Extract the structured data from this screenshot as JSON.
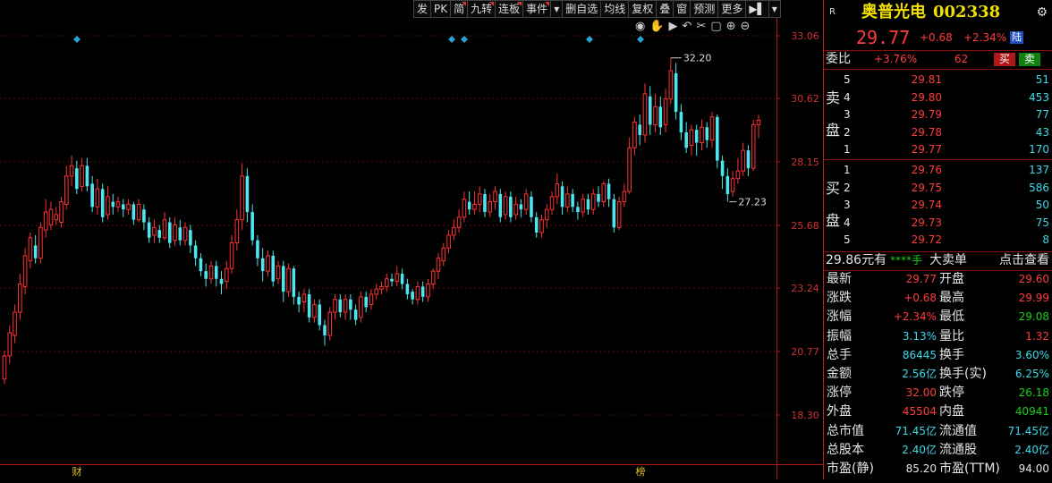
{
  "toolbar": {
    "buttons": [
      {
        "label": "发",
        "flag": false
      },
      {
        "label": "PK",
        "flag": false
      },
      {
        "label": "简",
        "flag": true
      },
      {
        "label": "九转",
        "flag": true
      },
      {
        "label": "连板",
        "flag": true
      },
      {
        "label": "事件",
        "flag": true
      },
      {
        "label": "▾",
        "flag": false
      },
      {
        "label": "删自选",
        "flag": false
      },
      {
        "label": "均线",
        "flag": false
      },
      {
        "label": "复权",
        "flag": false
      },
      {
        "label": "叠",
        "flag": false
      },
      {
        "label": "窗",
        "flag": false
      },
      {
        "label": "预测",
        "flag": false
      },
      {
        "label": "更多",
        "flag": false
      },
      {
        "label": "▶▌",
        "flag": false
      },
      {
        "label": "▾",
        "flag": false
      }
    ]
  },
  "chart_data": {
    "type": "candlestick",
    "y_ticks": [
      "33.06",
      "30.62",
      "28.15",
      "25.68",
      "23.24",
      "20.77",
      "18.30"
    ],
    "ylim": [
      18.3,
      33.06
    ],
    "high_label": "32.20",
    "low_label": "27.23",
    "bottom_markers": [
      "财",
      "榜"
    ],
    "colors": {
      "up": "#ff3232",
      "down": "#4ce6f0",
      "grid": "#5a0e0e",
      "axis": "#b01818",
      "diamond": "#2aa0d8"
    },
    "candles": [
      [
        19.7,
        20.6,
        19.5,
        20.8
      ],
      [
        20.6,
        21.5,
        20.3,
        21.8
      ],
      [
        21.4,
        22.3,
        21.1,
        22.6
      ],
      [
        22.3,
        23.4,
        22.0,
        23.8
      ],
      [
        23.3,
        24.5,
        23.0,
        24.8
      ],
      [
        24.3,
        25.2,
        24.0,
        25.4
      ],
      [
        24.9,
        24.4,
        24.2,
        25.3
      ],
      [
        24.4,
        25.6,
        24.2,
        25.8
      ],
      [
        25.5,
        26.2,
        25.2,
        26.7
      ],
      [
        25.7,
        26.3,
        25.5,
        26.6
      ],
      [
        25.9,
        26.1,
        25.7,
        26.4
      ],
      [
        25.8,
        26.6,
        25.6,
        26.8
      ],
      [
        26.5,
        27.6,
        26.3,
        28.0
      ],
      [
        27.6,
        28.0,
        27.2,
        28.4
      ],
      [
        27.9,
        27.1,
        26.9,
        28.2
      ],
      [
        27.2,
        28.0,
        27.0,
        28.3
      ],
      [
        28.0,
        27.2,
        27.0,
        28.3
      ],
      [
        27.3,
        26.4,
        26.2,
        27.6
      ],
      [
        26.4,
        27.1,
        26.1,
        27.5
      ],
      [
        27.1,
        26.0,
        25.8,
        27.3
      ],
      [
        26.1,
        26.8,
        25.9,
        27.2
      ],
      [
        26.6,
        26.4,
        26.1,
        26.9
      ],
      [
        26.4,
        26.6,
        26.2,
        26.8
      ],
      [
        26.5,
        26.3,
        26.0,
        26.7
      ],
      [
        26.3,
        26.5,
        26.1,
        26.7
      ],
      [
        26.5,
        25.9,
        25.7,
        26.6
      ],
      [
        25.9,
        26.5,
        25.8,
        26.7
      ],
      [
        26.3,
        25.8,
        25.5,
        26.5
      ],
      [
        25.8,
        25.2,
        25.0,
        26.0
      ],
      [
        25.3,
        25.6,
        25.0,
        25.9
      ],
      [
        25.5,
        25.2,
        25.0,
        25.7
      ],
      [
        25.2,
        25.9,
        25.1,
        26.2
      ],
      [
        25.8,
        25.0,
        24.8,
        26.0
      ],
      [
        25.1,
        25.7,
        24.9,
        26.0
      ],
      [
        25.6,
        25.1,
        24.9,
        25.9
      ],
      [
        25.1,
        25.6,
        24.9,
        25.8
      ],
      [
        25.5,
        24.9,
        24.6,
        25.7
      ],
      [
        24.9,
        24.4,
        24.1,
        25.1
      ],
      [
        24.4,
        23.9,
        23.7,
        24.6
      ],
      [
        23.9,
        23.6,
        23.3,
        24.2
      ],
      [
        23.6,
        24.1,
        23.4,
        24.3
      ],
      [
        24.1,
        23.6,
        23.3,
        24.3
      ],
      [
        23.6,
        23.4,
        23.0,
        23.9
      ],
      [
        23.5,
        24.0,
        23.2,
        24.3
      ],
      [
        24.0,
        25.0,
        23.8,
        25.3
      ],
      [
        25.0,
        25.9,
        24.7,
        26.3
      ],
      [
        25.9,
        27.6,
        25.5,
        28.1
      ],
      [
        27.6,
        26.2,
        25.8,
        27.9
      ],
      [
        26.2,
        25.1,
        24.9,
        26.5
      ],
      [
        25.1,
        24.4,
        24.1,
        25.3
      ],
      [
        24.4,
        23.9,
        23.5,
        24.8
      ],
      [
        23.9,
        24.5,
        23.7,
        24.7
      ],
      [
        24.5,
        23.5,
        23.3,
        24.7
      ],
      [
        23.6,
        24.1,
        23.4,
        24.3
      ],
      [
        24.1,
        23.1,
        22.7,
        24.3
      ],
      [
        23.1,
        24.0,
        22.9,
        24.2
      ],
      [
        24.0,
        22.9,
        22.6,
        24.1
      ],
      [
        22.9,
        22.6,
        22.3,
        23.1
      ],
      [
        22.7,
        23.0,
        22.3,
        23.2
      ],
      [
        23.0,
        22.1,
        21.9,
        23.2
      ],
      [
        22.1,
        22.6,
        21.9,
        22.8
      ],
      [
        22.6,
        21.8,
        21.6,
        22.8
      ],
      [
        21.8,
        21.4,
        21.0,
        22.0
      ],
      [
        21.4,
        22.3,
        21.2,
        22.5
      ],
      [
        22.3,
        22.8,
        22.0,
        23.0
      ],
      [
        22.8,
        22.3,
        22.1,
        23.0
      ],
      [
        22.3,
        22.8,
        22.0,
        23.0
      ],
      [
        22.8,
        22.4,
        22.0,
        23.0
      ],
      [
        22.4,
        22.0,
        21.8,
        22.6
      ],
      [
        22.1,
        22.9,
        21.9,
        23.1
      ],
      [
        22.9,
        22.5,
        22.3,
        23.1
      ],
      [
        22.6,
        23.0,
        22.4,
        23.2
      ],
      [
        23.0,
        23.2,
        22.8,
        23.4
      ],
      [
        23.2,
        23.3,
        23.0,
        23.5
      ],
      [
        23.3,
        23.6,
        23.1,
        23.8
      ],
      [
        23.6,
        23.5,
        23.3,
        23.8
      ],
      [
        23.5,
        23.8,
        23.3,
        24.1
      ],
      [
        23.8,
        23.4,
        23.2,
        24.0
      ],
      [
        23.4,
        23.0,
        22.8,
        23.6
      ],
      [
        23.1,
        22.8,
        22.6,
        23.2
      ],
      [
        22.8,
        23.3,
        22.6,
        23.5
      ],
      [
        23.3,
        22.9,
        22.7,
        23.5
      ],
      [
        22.9,
        23.4,
        22.7,
        23.6
      ],
      [
        23.4,
        23.9,
        23.2,
        24.0
      ],
      [
        23.9,
        24.4,
        23.6,
        24.6
      ],
      [
        24.3,
        24.8,
        24.1,
        25.0
      ],
      [
        24.8,
        25.3,
        24.6,
        25.5
      ],
      [
        25.3,
        25.6,
        25.1,
        25.9
      ],
      [
        25.6,
        26.0,
        25.4,
        26.3
      ],
      [
        26.0,
        26.7,
        25.8,
        27.0
      ],
      [
        26.6,
        26.3,
        26.1,
        27.0
      ],
      [
        26.3,
        26.5,
        26.1,
        27.0
      ],
      [
        26.5,
        26.9,
        26.2,
        27.2
      ],
      [
        26.9,
        26.2,
        26.0,
        27.1
      ],
      [
        26.2,
        26.6,
        26.0,
        26.9
      ],
      [
        26.6,
        27.0,
        26.3,
        27.2
      ],
      [
        26.9,
        26.0,
        25.8,
        27.1
      ],
      [
        26.1,
        26.8,
        25.9,
        27.0
      ],
      [
        26.8,
        26.0,
        25.8,
        27.0
      ],
      [
        26.1,
        26.5,
        25.9,
        26.8
      ],
      [
        26.5,
        26.3,
        26.0,
        26.7
      ],
      [
        26.3,
        26.9,
        26.1,
        27.1
      ],
      [
        26.8,
        26.0,
        25.8,
        27.0
      ],
      [
        26.0,
        25.4,
        25.2,
        26.2
      ],
      [
        25.4,
        25.9,
        25.2,
        26.1
      ],
      [
        25.9,
        26.3,
        25.6,
        26.5
      ],
      [
        26.3,
        26.8,
        26.1,
        27.0
      ],
      [
        26.8,
        27.3,
        26.5,
        27.7
      ],
      [
        27.2,
        26.4,
        26.1,
        27.4
      ],
      [
        26.4,
        26.9,
        26.2,
        27.2
      ],
      [
        26.9,
        26.4,
        26.2,
        27.1
      ],
      [
        26.4,
        26.2,
        25.9,
        26.6
      ],
      [
        26.2,
        26.7,
        26.0,
        26.9
      ],
      [
        26.7,
        26.3,
        26.1,
        26.9
      ],
      [
        26.3,
        26.9,
        26.1,
        27.1
      ],
      [
        26.9,
        26.6,
        26.4,
        27.2
      ],
      [
        26.6,
        27.3,
        26.4,
        27.4
      ],
      [
        27.3,
        26.7,
        26.4,
        27.5
      ],
      [
        26.7,
        25.6,
        25.4,
        26.9
      ],
      [
        25.6,
        26.6,
        25.5,
        26.8
      ],
      [
        26.6,
        27.0,
        26.4,
        27.3
      ],
      [
        27.0,
        28.7,
        26.9,
        29.1
      ],
      [
        28.7,
        29.7,
        28.4,
        29.9
      ],
      [
        29.6,
        29.2,
        28.8,
        30.0
      ],
      [
        29.2,
        30.8,
        28.9,
        31.2
      ],
      [
        30.7,
        29.6,
        29.2,
        31.1
      ],
      [
        29.6,
        30.3,
        29.3,
        30.8
      ],
      [
        30.3,
        29.5,
        29.2,
        30.7
      ],
      [
        29.6,
        30.6,
        29.3,
        31.0
      ],
      [
        30.6,
        31.7,
        30.4,
        32.2
      ],
      [
        31.6,
        30.1,
        29.8,
        32.0
      ],
      [
        30.1,
        29.3,
        29.0,
        30.4
      ],
      [
        29.3,
        28.7,
        28.5,
        29.7
      ],
      [
        28.8,
        29.4,
        28.4,
        29.6
      ],
      [
        29.4,
        28.9,
        28.4,
        29.6
      ],
      [
        28.9,
        29.5,
        28.6,
        29.8
      ],
      [
        29.5,
        29.0,
        28.7,
        29.7
      ],
      [
        29.0,
        29.9,
        28.7,
        30.1
      ],
      [
        29.9,
        28.2,
        27.9,
        30.0
      ],
      [
        28.2,
        27.6,
        27.1,
        28.4
      ],
      [
        27.6,
        26.9,
        26.6,
        27.9
      ],
      [
        27.0,
        27.5,
        26.8,
        27.8
      ],
      [
        27.5,
        27.8,
        27.3,
        28.3
      ],
      [
        27.8,
        28.6,
        27.6,
        28.9
      ],
      [
        28.6,
        27.9,
        27.6,
        28.8
      ],
      [
        27.9,
        29.6,
        27.8,
        29.8
      ],
      [
        29.6,
        29.77,
        29.08,
        29.99
      ]
    ],
    "diamonds_x": [
      86,
      505,
      519,
      659,
      716
    ]
  },
  "panel": {
    "badge": "R",
    "name": "奥普光电",
    "code": "002338",
    "price": "29.77",
    "change": "+0.68",
    "change_pct": "+2.34%",
    "market": "陆",
    "weibi_label": "委比",
    "weibi_value": "+3.76%",
    "weibi_diff": "62",
    "buy_btn": "买",
    "sell_btn": "卖",
    "sell_side_label": [
      "卖",
      "盘"
    ],
    "buy_side_label": [
      "买",
      "盘"
    ],
    "asks": [
      {
        "level": "5",
        "price": "29.81",
        "vol": "51"
      },
      {
        "level": "4",
        "price": "29.80",
        "vol": "453"
      },
      {
        "level": "3",
        "price": "29.79",
        "vol": "77"
      },
      {
        "level": "2",
        "price": "29.78",
        "vol": "43"
      },
      {
        "level": "1",
        "price": "29.77",
        "vol": "170"
      }
    ],
    "bids": [
      {
        "level": "1",
        "price": "29.76",
        "vol": "137"
      },
      {
        "level": "2",
        "price": "29.75",
        "vol": "586"
      },
      {
        "level": "3",
        "price": "29.74",
        "vol": "50"
      },
      {
        "level": "4",
        "price": "29.73",
        "vol": "75"
      },
      {
        "level": "5",
        "price": "29.72",
        "vol": "8"
      }
    ],
    "bigorder": {
      "amount": "29.86元有",
      "hands": "****手",
      "text": "大卖单",
      "link": "点击查看"
    },
    "stats": [
      {
        "l1": "最新",
        "v1": "29.77",
        "c1": "red",
        "l2": "开盘",
        "v2": "29.60",
        "c2": "red"
      },
      {
        "l1": "涨跌",
        "v1": "+0.68",
        "c1": "red",
        "l2": "最高",
        "v2": "29.99",
        "c2": "red"
      },
      {
        "l1": "涨幅",
        "v1": "+2.34%",
        "c1": "red",
        "l2": "最低",
        "v2": "29.08",
        "c2": "green"
      },
      {
        "l1": "振幅",
        "v1": "3.13%",
        "c1": "cyan",
        "l2": "量比",
        "v2": "1.32",
        "c2": "red"
      },
      {
        "l1": "总手",
        "v1": "86445",
        "c1": "cyan",
        "l2": "换手",
        "v2": "3.60%",
        "c2": "cyan"
      },
      {
        "l1": "金额",
        "v1": "2.56亿",
        "c1": "cyan",
        "l2": "换手(实)",
        "v2": "6.25%",
        "c2": "cyan"
      },
      {
        "l1": "涨停",
        "v1": "32.00",
        "c1": "red",
        "l2": "跌停",
        "v2": "26.18",
        "c2": "green"
      },
      {
        "l1": "外盘",
        "v1": "45504",
        "c1": "red",
        "l2": "内盘",
        "v2": "40941",
        "c2": "green"
      },
      {
        "l1": "总市值",
        "v1": "71.45亿",
        "c1": "cyan",
        "l2": "流通值",
        "v2": "71.45亿",
        "c2": "cyan"
      },
      {
        "l1": "总股本",
        "v1": "2.40亿",
        "c1": "cyan",
        "l2": "流通股",
        "v2": "2.40亿",
        "c2": "cyan"
      },
      {
        "l1": "市盈(静)",
        "v1": "85.20",
        "c1": "white",
        "l2": "市盈(TTM)",
        "v2": "94.00",
        "c2": "white"
      }
    ]
  }
}
